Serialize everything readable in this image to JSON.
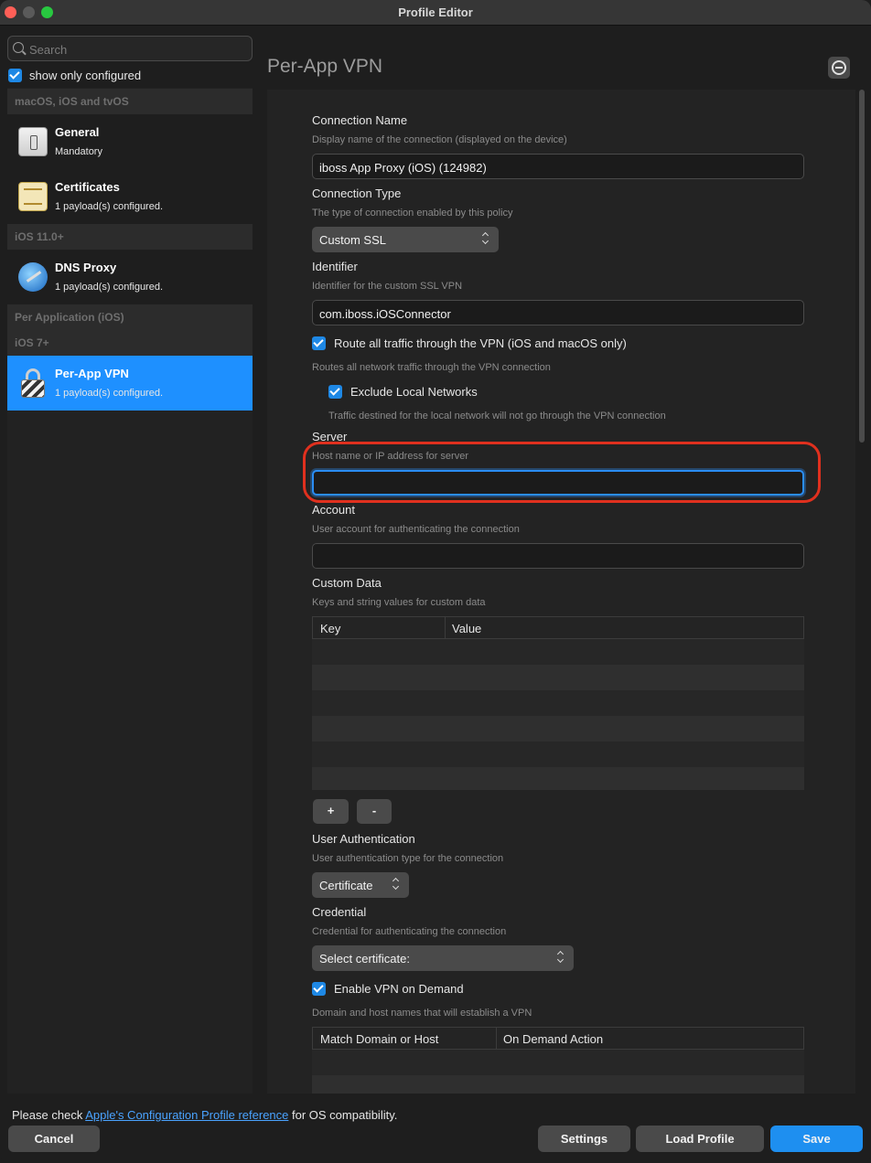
{
  "window": {
    "title": "Profile Editor"
  },
  "sidebar": {
    "search_placeholder": "Search",
    "show_only_configured": "show only configured",
    "groups": [
      {
        "header": "macOS, iOS and tvOS"
      },
      {
        "header": "iOS 11.0+"
      },
      {
        "header": "Per Application (iOS)"
      },
      {
        "header": "iOS 7+"
      }
    ],
    "items": [
      {
        "title": "General",
        "subtitle": "Mandatory",
        "icon": "general-switch-icon"
      },
      {
        "title": "Certificates",
        "subtitle": "1 payload(s) configured.",
        "icon": "certificate-icon"
      },
      {
        "title": "DNS Proxy",
        "subtitle": "1 payload(s) configured.",
        "icon": "dns-globe-icon"
      },
      {
        "title": "Per-App VPN",
        "subtitle": "1 payload(s) configured.",
        "icon": "lock-icon"
      }
    ]
  },
  "main": {
    "title": "Per-App VPN",
    "connection_name": {
      "label": "Connection Name",
      "desc": "Display name of the connection (displayed on the device)",
      "value": "iboss App Proxy (iOS) (124982)"
    },
    "connection_type": {
      "label": "Connection Type",
      "desc": "The type of connection enabled by this policy",
      "value": "Custom SSL"
    },
    "identifier": {
      "label": "Identifier",
      "desc": "Identifier for the custom SSL VPN",
      "value": "com.iboss.iOSConnector"
    },
    "route_all": {
      "label": "Route all traffic through the VPN (iOS and macOS only)",
      "desc": "Routes all network traffic through the VPN connection"
    },
    "exclude_local": {
      "label": "Exclude Local Networks",
      "desc": "Traffic destined for the local network will not go through the VPN connection"
    },
    "server": {
      "label": "Server",
      "desc": "Host name or IP address for server",
      "value": ""
    },
    "account": {
      "label": "Account",
      "desc": "User account for authenticating the connection",
      "value": ""
    },
    "custom_data": {
      "label": "Custom Data",
      "desc": "Keys and string values for custom data",
      "col_key": "Key",
      "col_value": "Value",
      "add": "+",
      "remove": "-"
    },
    "user_auth": {
      "label": "User Authentication",
      "desc": "User authentication type for the connection",
      "value": "Certificate"
    },
    "credential": {
      "label": "Credential",
      "desc": "Credential for authenticating the connection",
      "value": "Select certificate:"
    },
    "vpn_on_demand": {
      "label": "Enable VPN on Demand",
      "desc": "Domain and host names that will establish a VPN",
      "col_domain": "Match Domain or Host",
      "col_action": "On Demand Action"
    }
  },
  "footer": {
    "note_prefix": "Please check ",
    "note_link": "Apple's Configuration Profile reference",
    "note_suffix": " for OS compatibility.",
    "cancel": "Cancel",
    "settings": "Settings",
    "load_profile": "Load Profile",
    "save": "Save"
  },
  "colors": {
    "accent": "#1e8ff0",
    "highlight": "#e0301e"
  }
}
